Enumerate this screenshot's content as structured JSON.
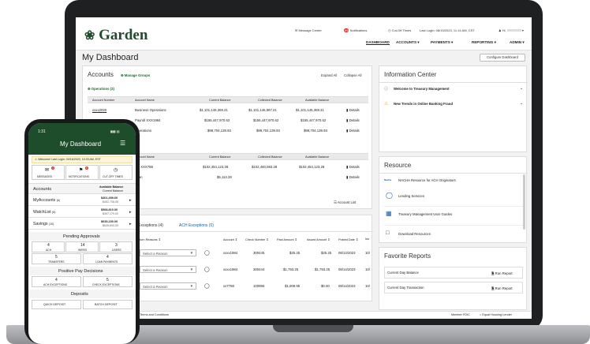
{
  "header": {
    "brand": "Garden",
    "message_center": "Message Center",
    "notifications": "Notifications",
    "notif_badge": "99",
    "cutoff": "Cut-Off Times",
    "last_login": "Last Login: 08/15/2023, 11:14 AM, CST",
    "user": "Hi,",
    "nav": [
      "DASHBOARD",
      "ACCOUNTS",
      "PAYMENTS",
      "REPORTING",
      "ADMIN"
    ]
  },
  "page": {
    "title": "My Dashboard",
    "configure": "Configure Dashboard"
  },
  "accounts": {
    "title": "Accounts",
    "manage": "Manage Groups",
    "expand": "Expand All",
    "collapse": "Collapse All",
    "group1": "Operations (3)",
    "headers": [
      "Account Number",
      "Account Name",
      "Current Balance",
      "Collected Balance",
      "Available Balance"
    ],
    "rows1": [
      {
        "num": "xxxx2020",
        "name": "Business Operations",
        "cur": "$1,101,145,369.31",
        "col": "$1,101,146,987.21",
        "avail": "$1,101,145,369.31"
      },
      {
        "num": "",
        "name": "Payroll XXX1984",
        "cur": "$155,447,970.62",
        "col": "$155,447,970.62",
        "avail": "$155,447,970.62"
      },
      {
        "num": "",
        "name": "Operations",
        "cur": "$99,704,139.93",
        "col": "$99,704,139.93",
        "avail": "$99,704,139.93"
      }
    ],
    "rows2": [
      {
        "name": "BC XXX788",
        "cur": "$102,454,123.28",
        "col": "$102,460,583.28",
        "avail": "$102,454,123.28"
      },
      {
        "name": "Loan",
        "cur": "$5,113.28",
        "col": "",
        "avail": ""
      }
    ],
    "details": "Details",
    "account_list": "Account List"
  },
  "exceptions": {
    "tab1": "Exceptions (4)",
    "tab2": "ACH Exceptions (0)",
    "headers": [
      "turn Reasons",
      "Account",
      "Check Number",
      "Paid Amount",
      "Issued Amount",
      "Posted Date",
      "Iss"
    ],
    "placeholder": "Select a Reason",
    "rows": [
      {
        "acct": "xxxx1984",
        "check": "300445",
        "paid": "$25.25",
        "issued": "$25.25",
        "date": "08/14/2023",
        "iss": "10/"
      },
      {
        "acct": "xxxx1984",
        "check": "300444",
        "paid": "$1,793.25",
        "issued": "$1,793.25",
        "date": "08/14/2023",
        "iss": "10/"
      },
      {
        "acct": "xx7788",
        "check": "100995",
        "paid": "$1,009.95",
        "issued": "$0.00",
        "date": "08/14/2023",
        "iss": "10/"
      }
    ]
  },
  "info": {
    "title": "Information Center",
    "items": [
      "Welcome to Treasury Management",
      "New Trends in Online Banking Fraud"
    ]
  },
  "resource": {
    "title": "Resource",
    "items": [
      "NACHA Resource for ACH Originators",
      "Lending Services",
      "Treasury Management User Guides",
      "Download Resources"
    ]
  },
  "reports": {
    "title": "Favorite Reports",
    "items": [
      "Current Day Balance",
      "Current Day Transaction"
    ],
    "run": "Run Report"
  },
  "footer": {
    "left": "Inc.  |  Terms and Conditions",
    "fdic": "Member FDIC",
    "ehl": "Equal Housing Lender"
  },
  "phone": {
    "time": "1:31",
    "title": "My Dashboard",
    "welcome": "Welcome! Last Login: 03/16/2023, 10:33 AM, EST",
    "shortcuts": [
      "MESSAGES",
      "NOTIFICATIONS",
      "CUT-OFF TIMES"
    ],
    "badges": [
      "3",
      "8"
    ],
    "acc_title": "Accounts",
    "avail_label": "Available Balance",
    "cur_label": "Current Balance",
    "accounts": [
      {
        "name": "MyAccounts",
        "count": "(6)",
        "avail": "$401,459.60",
        "cur": "$452,708.55"
      },
      {
        "name": "WatchList",
        "count": "(6)",
        "avail": "$568,810.00",
        "cur": "$307,179.00"
      },
      {
        "name": "Savings",
        "count": "(10)",
        "avail": "$635,150.00",
        "cur": "$635,600.00"
      }
    ],
    "pending_title": "Pending Approvals",
    "pending": [
      {
        "n": "4",
        "l": "ACH"
      },
      {
        "n": "14",
        "l": "WIRES"
      },
      {
        "n": "3",
        "l": "USERS"
      },
      {
        "n": "5",
        "l": "TRANSFERS"
      },
      {
        "n": "4",
        "l": "LOAN PAYMENTS"
      }
    ],
    "positive_title": "Positive Pay Decisions",
    "positive": [
      {
        "n": "4",
        "l": "ACH EXCEPTIONS"
      },
      {
        "n": "5",
        "l": "CHECK EXCEPTIONS"
      }
    ],
    "deposits_title": "Deposits",
    "deposits": [
      "QUICK DEPOSIT",
      "BATCH DEPOSIT"
    ]
  },
  "colors": {
    "brand": "#1e4d2b",
    "link": "#1b5fa8",
    "badge": "#d9342b"
  }
}
